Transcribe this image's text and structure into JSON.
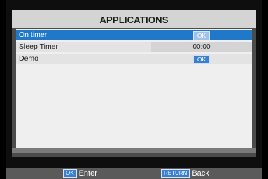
{
  "panel": {
    "title": "APPLICATIONS"
  },
  "items": [
    {
      "label": "On timer",
      "value": "OK",
      "selected": true
    },
    {
      "label": "Sleep Timer",
      "value": "00:00",
      "selected": false
    },
    {
      "label": "Demo",
      "value": "OK",
      "selected": false
    }
  ],
  "footer": {
    "enter_key": "OK",
    "enter_label": "Enter",
    "back_key": "RETURN",
    "back_label": "Back"
  },
  "colors": {
    "selection": "#1f78c8",
    "key_badge": "#3b7fd0"
  }
}
